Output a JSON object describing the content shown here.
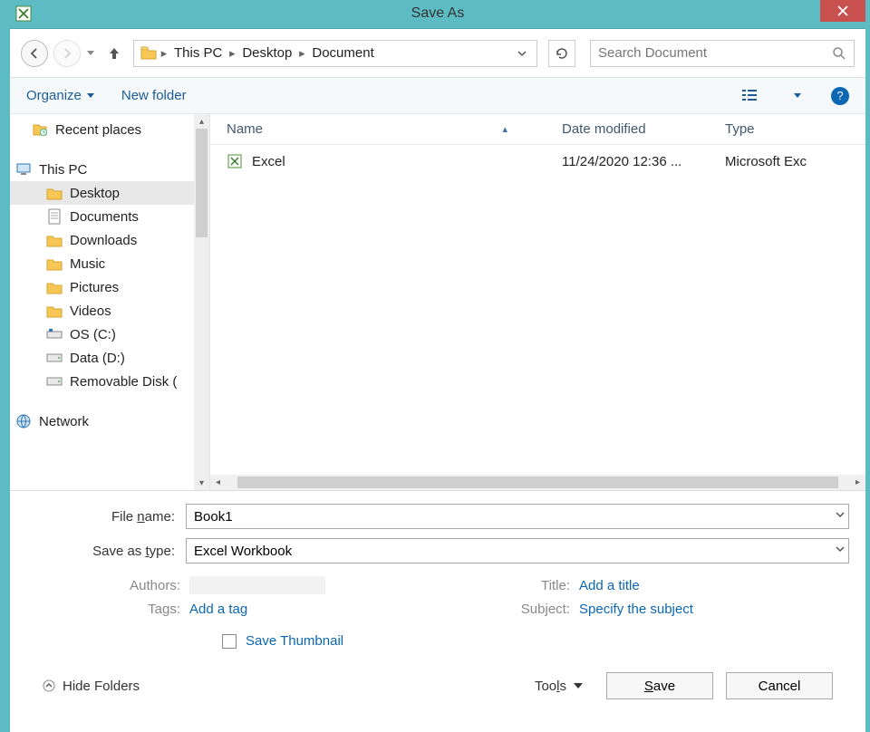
{
  "titlebar": {
    "title": "Save As"
  },
  "nav": {
    "breadcrumb": [
      "This PC",
      "Desktop",
      "Document"
    ],
    "search_placeholder": "Search Document"
  },
  "toolbar": {
    "organize": "Organize",
    "new_folder": "New folder"
  },
  "tree": {
    "items": [
      {
        "label": "Recent places",
        "indent": 1,
        "icon": "recent"
      },
      {
        "gap": true
      },
      {
        "label": "This PC",
        "indent": 0,
        "icon": "pc"
      },
      {
        "label": "Desktop",
        "indent": 2,
        "icon": "folder",
        "selected": true
      },
      {
        "label": "Documents",
        "indent": 2,
        "icon": "doc"
      },
      {
        "label": "Downloads",
        "indent": 2,
        "icon": "folder"
      },
      {
        "label": "Music",
        "indent": 2,
        "icon": "folder"
      },
      {
        "label": "Pictures",
        "indent": 2,
        "icon": "folder"
      },
      {
        "label": "Videos",
        "indent": 2,
        "icon": "folder"
      },
      {
        "label": "OS (C:)",
        "indent": 2,
        "icon": "drive"
      },
      {
        "label": "Data (D:)",
        "indent": 2,
        "icon": "drive2"
      },
      {
        "label": "Removable Disk (",
        "indent": 2,
        "icon": "drive2"
      },
      {
        "gap": true
      },
      {
        "label": "Network",
        "indent": 0,
        "icon": "network"
      }
    ]
  },
  "columns": {
    "name": "Name",
    "date": "Date modified",
    "type": "Type"
  },
  "files": [
    {
      "name": "Excel",
      "date": "11/24/2020 12:36 ...",
      "type": "Microsoft Exc"
    }
  ],
  "form": {
    "filename_label": "File name:",
    "filename_value": "Book1",
    "saveastype_label": "Save as type:",
    "saveastype_value": "Excel Workbook",
    "authors_label": "Authors:",
    "tags_label": "Tags:",
    "tags_value": "Add a tag",
    "title_label": "Title:",
    "title_value": "Add a title",
    "subject_label": "Subject:",
    "subject_value": "Specify the subject",
    "save_thumbnail": "Save Thumbnail"
  },
  "footer": {
    "hide_folders": "Hide Folders",
    "tools": "Tools",
    "save": "Save",
    "cancel": "Cancel"
  }
}
